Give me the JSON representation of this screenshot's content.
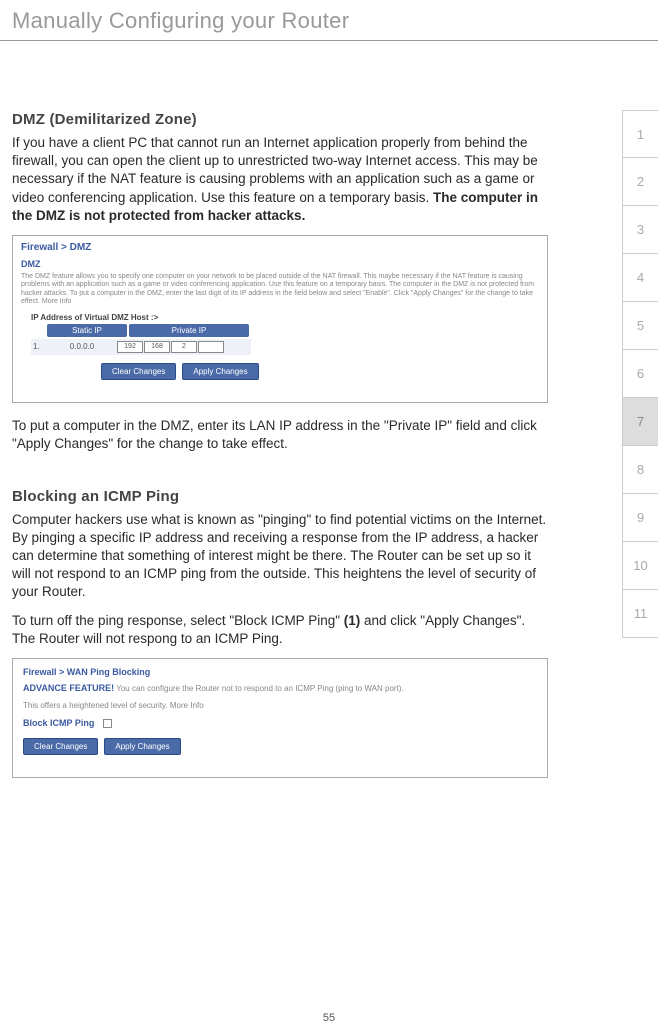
{
  "page_title": "Manually Configuring your Router",
  "page_number": "55",
  "dmz": {
    "heading": "DMZ (Demilitarized Zone)",
    "p1_a": "If you have a client PC that cannot run an Internet application properly from behind the firewall, you can open the client up to unrestricted two-way Internet access. This may be necessary if the NAT feature is causing problems with an application such as a game or video conferencing application. Use this feature on a temporary basis. ",
    "p1_b": "The computer in the DMZ is not protected from hacker attacks.",
    "p2": "To put a computer in the DMZ, enter its LAN IP address in the \"Private IP\" field and click \"Apply Changes\" for the change to take effect."
  },
  "ping": {
    "heading": "Blocking an ICMP Ping",
    "p1": "Computer hackers use what is known as \"pinging\" to find potential victims on the Internet. By pinging a specific IP address and receiving a response from the IP address, a hacker can determine that something of interest might be there. The Router can be set up so it will not respond to an ICMP ping from the outside. This heightens the level of security of your Router.",
    "p2_a": "To turn off the ping response, select \"Block ICMP Ping\" ",
    "p2_ref": "(1)",
    "p2_b": " and click \"Apply Changes\". The Router will not respong to an ICMP Ping."
  },
  "shot_dmz": {
    "breadcrumb": "Firewall > DMZ",
    "sub": "DMZ",
    "desc": "The DMZ feature allows you to specify one computer on your network to be placed outside of the NAT firewall. This maybe necessary if the NAT feature is causing problems with an application such as a game or video conferencing application. Use this feature on a temporary basis. The computer in the DMZ is not protected from hacker attacks. To put a computer in the DMZ, enter the last digit of its IP address in the field below and select \"Enable\". Click \"Apply Changes\" for the change to take effect. More Info",
    "label": "IP Address of Virtual DMZ Host :>",
    "col_static": "Static IP",
    "col_private": "Private IP",
    "row_num": "1.",
    "static_val": "0.0.0.0",
    "ip": [
      "192",
      "168",
      "2",
      ""
    ],
    "btn_clear": "Clear Changes",
    "btn_apply": "Apply Changes"
  },
  "shot_wan": {
    "breadcrumb": "Firewall > WAN Ping Blocking",
    "adv_label": "ADVANCE FEATURE!",
    "adv_text": " You can configure the Router not to respond to an ICMP Ping (ping to WAN port).",
    "line2": "This offers a heightened level of security. More Info",
    "block_label": "Block ICMP Ping",
    "btn_clear": "Clear Changes",
    "btn_apply": "Apply Changes"
  },
  "tabs": [
    "1",
    "2",
    "3",
    "4",
    "5",
    "6",
    "7",
    "8",
    "9",
    "10",
    "11"
  ],
  "active_tab": "7"
}
